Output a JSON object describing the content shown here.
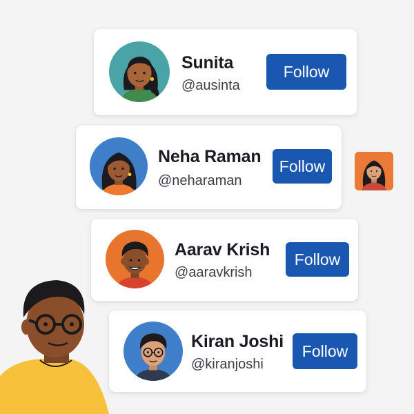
{
  "suggestions": [
    {
      "name": "Sunita",
      "handle": "@ausinta",
      "button": "Follow",
      "avatar_bg": "#4aa3a6"
    },
    {
      "name": "Neha Raman",
      "handle": "@neharaman",
      "button": "Follow",
      "avatar_bg": "#3f7fc9"
    },
    {
      "name": "Aarav Krish",
      "handle": "@aaravkrish",
      "button": "Follow",
      "avatar_bg": "#e8752e"
    },
    {
      "name": "Kiran Joshi",
      "handle": "@kiranjoshi",
      "button": "Follow",
      "avatar_bg": "#3f7fc9"
    }
  ],
  "colors": {
    "background": "#f4f4f5",
    "card": "#ffffff",
    "button": "#1a57b0",
    "button_text": "#ffffff",
    "name_text": "#1b1b24",
    "handle_text": "#3d3d48"
  },
  "icons": {
    "side_thumbnail": "woman-avatar-thumbnail",
    "illustration": "man-with-glasses-illustration"
  }
}
